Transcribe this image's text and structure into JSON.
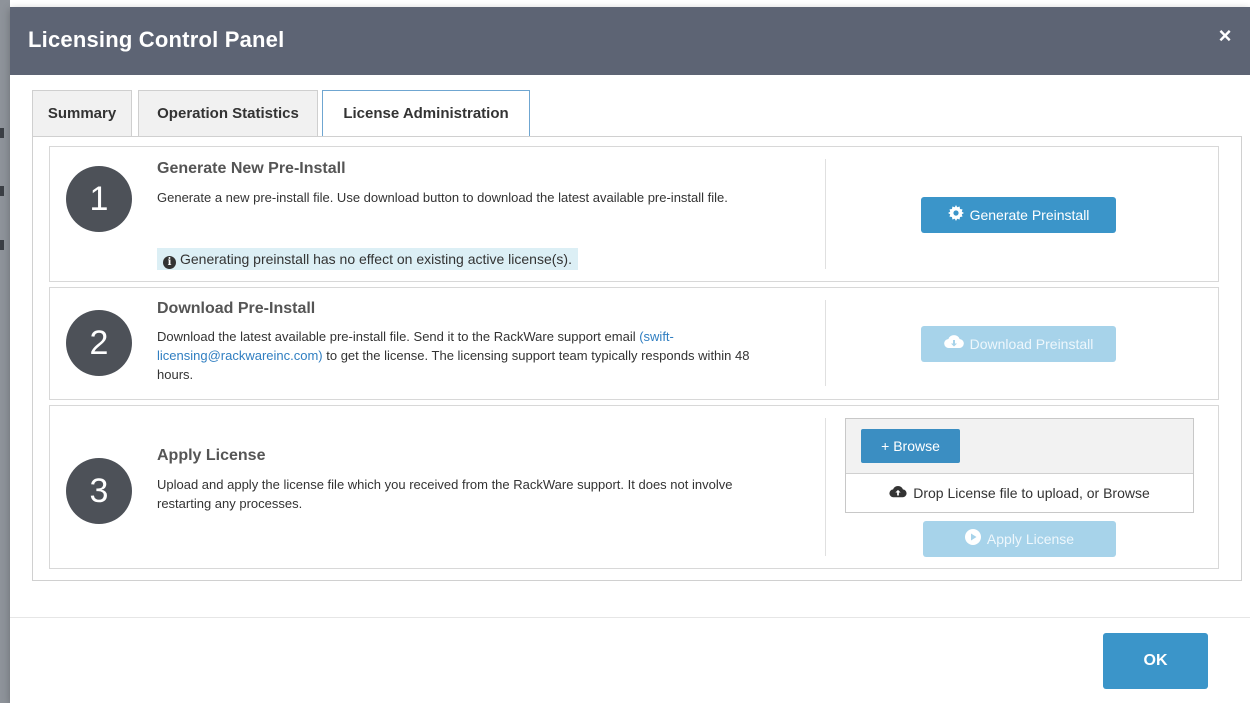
{
  "dialog": {
    "title": "Licensing Control Panel",
    "close_symbol": "×"
  },
  "tabs": [
    {
      "label": "Summary",
      "active": false
    },
    {
      "label": "Operation Statistics",
      "active": false
    },
    {
      "label": "License Administration",
      "active": true
    }
  ],
  "steps": [
    {
      "number": "1",
      "title": "Generate New Pre-Install",
      "description": "Generate a new pre-install file. Use download button to download the latest available pre-install file.",
      "note": "Generating preinstall has no effect on existing active license(s).",
      "button_label": "Generate Preinstall",
      "button_icon": "gear-icon"
    },
    {
      "number": "2",
      "title": "Download Pre-Install",
      "description_before": "Download the latest available pre-install file. Send it to the RackWare support email ",
      "email_link": "(swift-licensing@rackwareinc.com)",
      "description_after": " to get the license. The licensing support team typically responds within 48 hours.",
      "button_label": "Download Preinstall",
      "button_icon": "cloud-download-icon"
    },
    {
      "number": "3",
      "title": "Apply License",
      "description": "Upload and apply the license file which you received from the RackWare support. It does not involve restarting any processes.",
      "browse_label": "+ Browse",
      "drop_text": "Drop License file to upload, or Browse",
      "drop_icon": "cloud-upload-icon",
      "button_label": "Apply License",
      "button_icon": "play-circle-icon"
    }
  ],
  "footer": {
    "ok_label": "OK"
  },
  "colors": {
    "header": "#5d6474",
    "primary": "#3b95c9",
    "disabled": "#a7d3ea",
    "info_bg": "#dceff5",
    "step_circle": "#4d5158"
  }
}
